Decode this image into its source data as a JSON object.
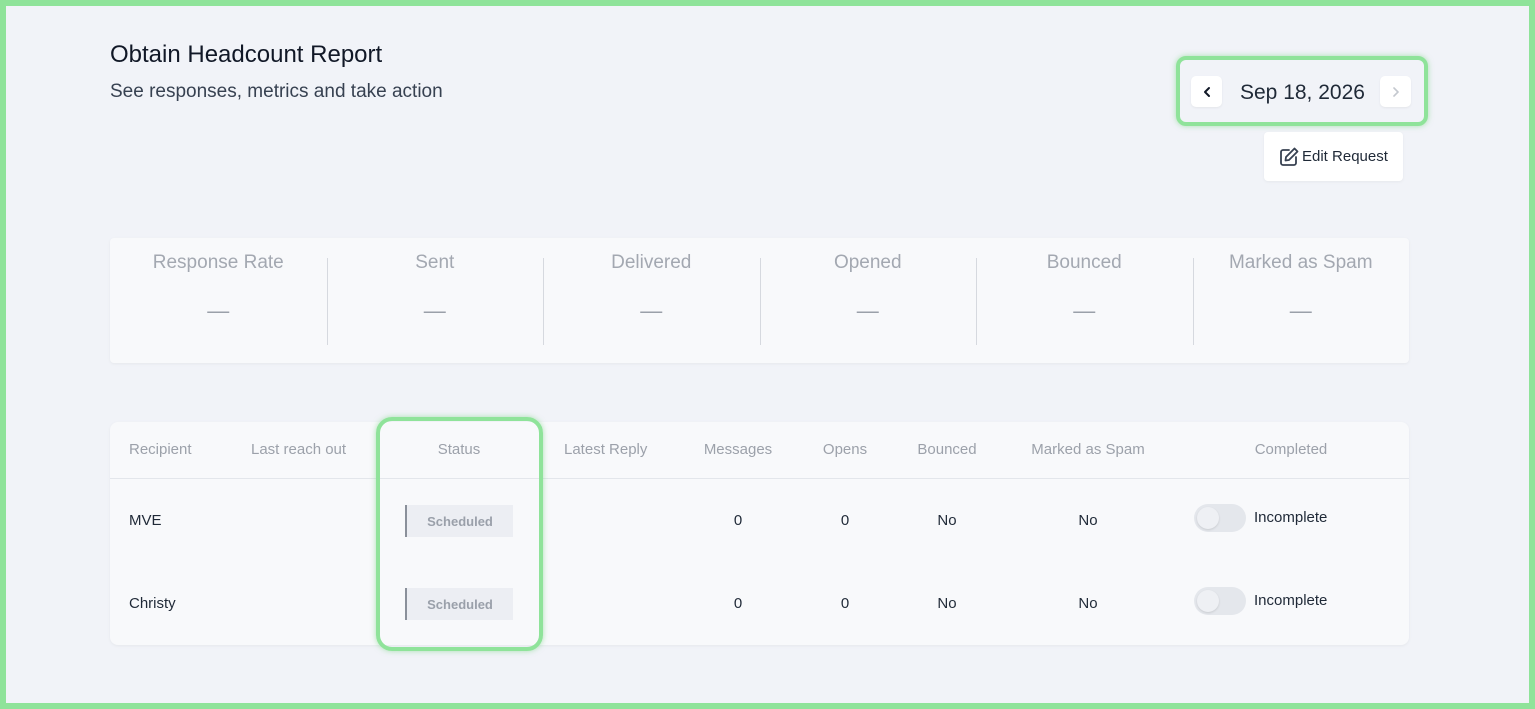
{
  "header": {
    "title": "Obtain Headcount Report",
    "subtitle": "See responses, metrics and take action"
  },
  "date_nav": {
    "date": "Sep 18, 2026",
    "prev_icon": "chevron-left-icon",
    "next_icon": "chevron-right-icon"
  },
  "actions": {
    "edit_label": "Edit Request",
    "edit_icon": "edit-icon"
  },
  "metrics": [
    {
      "label": "Response Rate",
      "value": "—"
    },
    {
      "label": "Sent",
      "value": "—"
    },
    {
      "label": "Delivered",
      "value": "—"
    },
    {
      "label": "Opened",
      "value": "—"
    },
    {
      "label": "Bounced",
      "value": "—"
    },
    {
      "label": "Marked as Spam",
      "value": "—"
    }
  ],
  "table": {
    "columns": [
      "Recipient",
      "Last reach out",
      "Status",
      "Latest Reply",
      "Messages",
      "Opens",
      "Bounced",
      "Marked as Spam",
      "Completed"
    ],
    "rows": [
      {
        "recipient": "MVE",
        "last_reach_out": "",
        "status": "Scheduled",
        "latest_reply": "",
        "messages": "0",
        "opens": "0",
        "bounced": "No",
        "spam": "No",
        "completed_on": false,
        "completed_label": "Incomplete"
      },
      {
        "recipient": "Christy",
        "last_reach_out": "",
        "status": "Scheduled",
        "latest_reply": "",
        "messages": "0",
        "opens": "0",
        "bounced": "No",
        "spam": "No",
        "completed_on": false,
        "completed_label": "Incomplete"
      }
    ]
  },
  "colors": {
    "highlight": "#8fe39a",
    "background": "#f1f3f8",
    "card": "#f8f9fb"
  }
}
